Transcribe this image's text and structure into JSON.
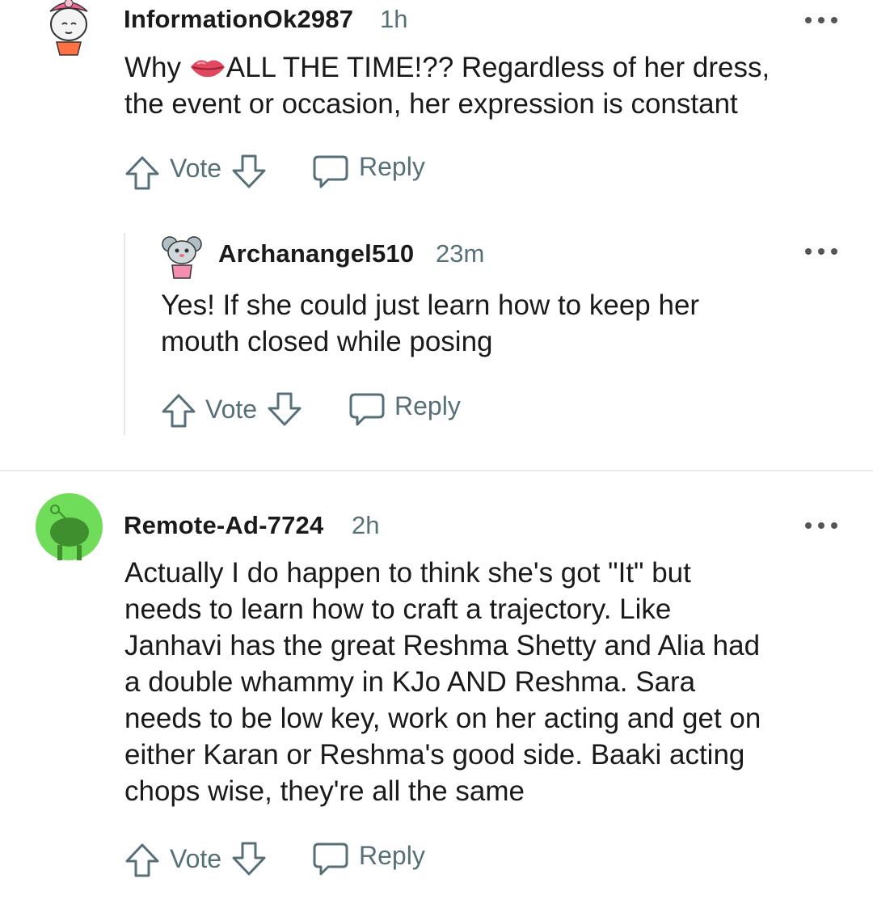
{
  "comments": [
    {
      "username": "InformationOk2987",
      "time": "1h",
      "lines": [
        {
          "before": "Why ",
          "emoji": "lips-emoji",
          "after": "ALL THE TIME!?? Regardless of her dress,"
        },
        {
          "before": "the event or occasion, her expression is constant",
          "emoji": "",
          "after": ""
        }
      ],
      "vote_label": "Vote",
      "reply_label": "Reply"
    },
    {
      "username": "Archanangel510",
      "time": "23m",
      "lines": [
        "Yes! If she could just learn how to keep her",
        "mouth closed while posing"
      ],
      "vote_label": "Vote",
      "reply_label": "Reply"
    },
    {
      "username": "Remote-Ad-7724",
      "time": "2h",
      "lines": [
        "Actually I do happen to think she's got \"It\" but",
        "needs to learn how to craft a trajectory. Like",
        "Janhavi has the great Reshma Shetty and Alia had",
        "a double whammy in KJo AND Reshma. Sara",
        "needs to be low key, work on her acting and get on",
        "either Karan or Reshma's good side. Baaki acting",
        "chops wise, they're all the same"
      ],
      "vote_label": "Vote",
      "reply_label": "Reply"
    }
  ],
  "icons": {
    "upvote": "arrow-up-icon",
    "downvote": "arrow-down-icon",
    "reply": "speech-bubble-icon",
    "more": "ellipsis-icon"
  },
  "colors": {
    "username": "#1a1a1b",
    "meta": "#576f76",
    "avatar_green": "#6fdc5a",
    "lips": "#e0485f"
  }
}
